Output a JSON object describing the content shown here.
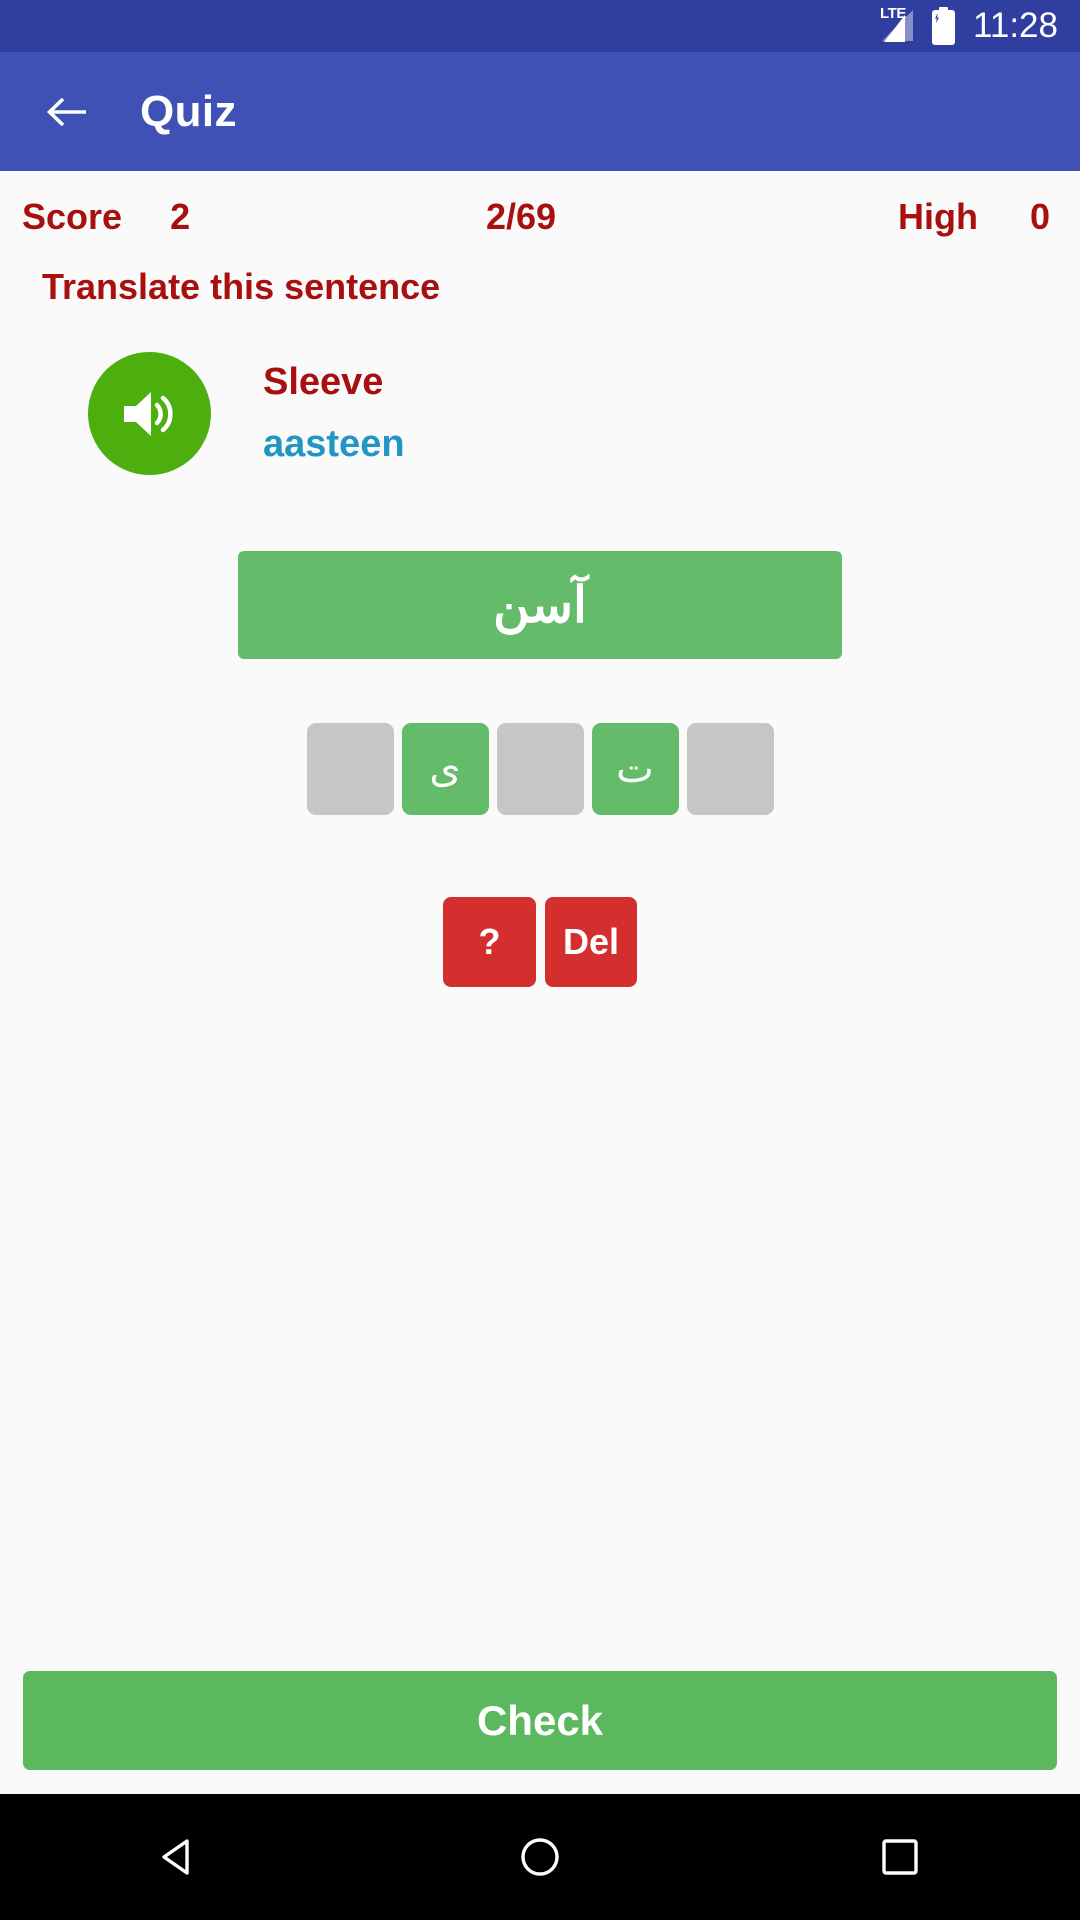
{
  "status_bar": {
    "network_label": "LTE",
    "time": "11:28",
    "signal_icon": "signal-bars-icon",
    "battery_icon": "battery-charging-icon",
    "background_color": "#303f9f"
  },
  "app_bar": {
    "back_icon": "back-arrow-icon",
    "title": "Quiz",
    "background_color": "#3f51b5"
  },
  "score_row": {
    "score_label": "Score",
    "score_value": "2",
    "progress": "2/69",
    "high_label": "High",
    "high_value": "0",
    "text_color": "#a81010"
  },
  "instruction": {
    "text": "Translate this sentence"
  },
  "prompt": {
    "speaker_icon": "speaker-volume-icon",
    "speaker_color": "#4caf0e",
    "english": "Sleeve",
    "transliteration": "aasteen",
    "english_color": "#a81010",
    "transliteration_color": "#2196c4"
  },
  "answer": {
    "text": "آسن",
    "background_color": "#64bb6a"
  },
  "tiles": [
    {
      "letter": "",
      "state": "empty"
    },
    {
      "letter": "ی",
      "state": "filled"
    },
    {
      "letter": "",
      "state": "empty"
    },
    {
      "letter": "ت",
      "state": "filled"
    },
    {
      "letter": "",
      "state": "empty"
    }
  ],
  "actions": {
    "hint_label": "?",
    "delete_label": "Del",
    "button_color": "#d32f2f"
  },
  "check": {
    "label": "Check",
    "background_color": "#5cb85f"
  },
  "nav_bar": {
    "back_icon": "nav-back-triangle-icon",
    "home_icon": "nav-home-circle-icon",
    "recents_icon": "nav-recents-square-icon",
    "background_color": "#000000"
  }
}
